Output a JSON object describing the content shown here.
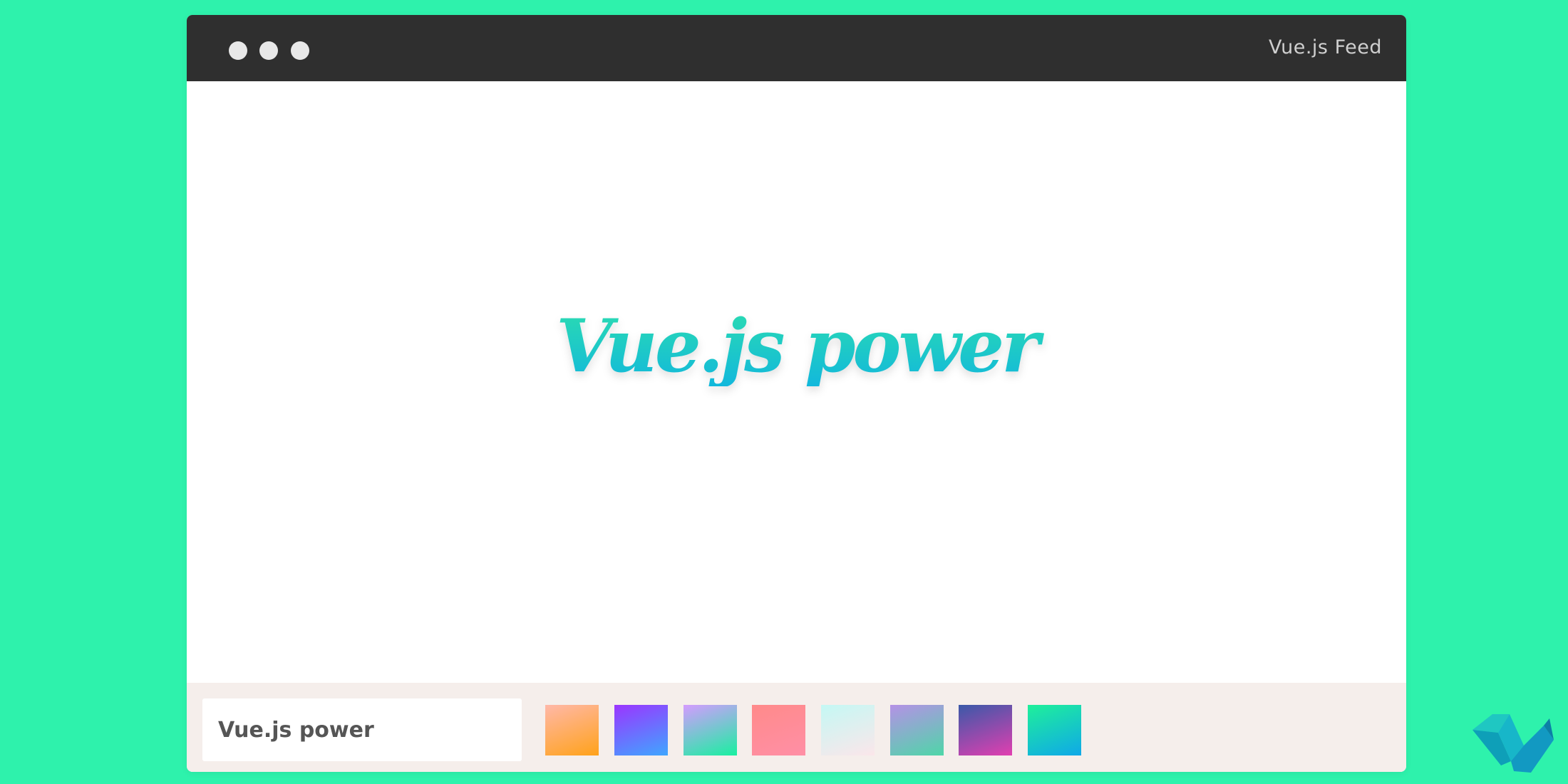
{
  "window": {
    "title": "Vue.js Feed"
  },
  "preview": {
    "text": "Vue.js power",
    "gradient_colors": [
      "#2bdcb0",
      "#12b8dc"
    ]
  },
  "toolbar": {
    "text_input_value": "Vue.js power",
    "swatches": [
      {
        "name": "peach-orange",
        "from": "#ffb8a8",
        "to": "#ffa21a"
      },
      {
        "name": "purple-blue",
        "from": "#9b35ff",
        "to": "#3fa6ff"
      },
      {
        "name": "lilac-cyan-green",
        "from": "#d49bff",
        "to": "#18f0a0"
      },
      {
        "name": "pink-red",
        "from": "#ff8a8a",
        "to": "#ff8fa6"
      },
      {
        "name": "mint-pink",
        "from": "#c4f8f4",
        "to": "#fbe6ea"
      },
      {
        "name": "violet-green",
        "from": "#b591e6",
        "to": "#4ed6a8"
      },
      {
        "name": "navy-magenta",
        "from": "#3a59a8",
        "to": "#e23fb0"
      },
      {
        "name": "green-blue",
        "from": "#1ff09a",
        "to": "#0fa8e8"
      }
    ]
  },
  "colors": {
    "background": "#2ef2ac",
    "titlebar": "#2f2f2f",
    "toolbar": "#f5eeeb"
  }
}
